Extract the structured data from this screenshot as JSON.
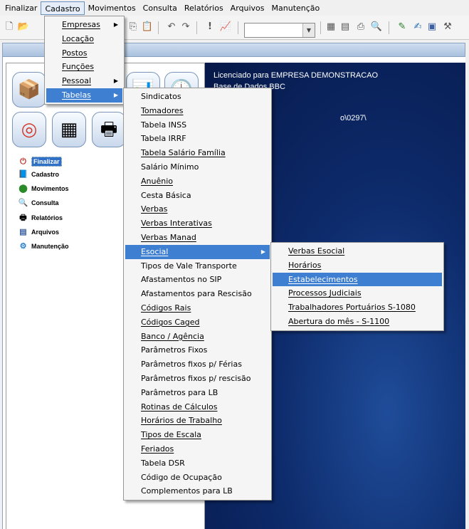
{
  "menubar": {
    "items": [
      "Finalizar",
      "Cadastro",
      "Movimentos",
      "Consulta",
      "Relatórios",
      "Arquivos",
      "Manutenção"
    ],
    "active_index": 1
  },
  "toolbar": {
    "icons": [
      "new-document-icon",
      "open-folder-icon",
      "paste-icon",
      "clipboard-icon",
      "undo-icon",
      "redo-icon",
      "exclamation-icon",
      "chart-icon",
      "dropdown-combo",
      "calculator-icon",
      "print-icon",
      "export-icon",
      "preview-icon",
      "tools-icon",
      "edit-icon",
      "window-icon",
      "settings-icon"
    ]
  },
  "info": {
    "line1": "Licenciado para EMPRESA DEMONSTRACAO",
    "line2": "Base de Dados BBC",
    "line3": "o\\0297\\"
  },
  "side_menu": {
    "items": [
      "Finalizar",
      "Cadastro",
      "Movimentos",
      "Consulta",
      "Relatórios",
      "Arquivos",
      "Manutenção"
    ],
    "selected_index": 0
  },
  "cadastro_menu": {
    "items": [
      {
        "label": "Empresas",
        "submenu": true
      },
      {
        "label": "Locação",
        "submenu": false
      },
      {
        "label": "Postos",
        "submenu": false
      },
      {
        "label": "Funções",
        "submenu": false
      },
      {
        "label": "Pessoal",
        "submenu": true
      },
      {
        "label": "Tabelas",
        "submenu": true
      }
    ],
    "highlighted": 5
  },
  "tabelas_menu": {
    "items": [
      "Sindicatos",
      "Tomadores",
      "Tabela INSS",
      "Tabela IRRF",
      "Tabela Salário Família",
      "Salário Mínimo",
      "Anuênio",
      "Cesta Básica",
      "Verbas",
      "Verbas Interativas",
      "Verbas Manad",
      "Esocial",
      "Tipos de Vale Transporte",
      "Afastamentos no SIP",
      "Afastamentos para Rescisão",
      "Códigos Rais",
      "Códigos Caged",
      "Banco / Agência",
      "Parâmetros Fixos",
      "Parâmetros fixos p/ Férias",
      "Parâmetros fixos p/ rescisão",
      "Parâmetros para LB",
      "Rotinas de Cálculos",
      "Horários de Trabalho",
      "Tipos de Escala",
      "Feriados",
      "Tabela DSR",
      "Código de Ocupação",
      "Complementos para LB"
    ],
    "highlighted": 11,
    "submenu_index": 11
  },
  "esocial_menu": {
    "items": [
      "Verbas Esocial",
      "Horários",
      "Estabelecimentos",
      "Processos Judiciais",
      "Trabalhadores Portuários S-1080",
      "Abertura do mês - S-1100"
    ],
    "highlighted": 2
  },
  "colors": {
    "menu_highlight": "#3e7fd1",
    "desktop_blue": "#0d2a6a"
  }
}
